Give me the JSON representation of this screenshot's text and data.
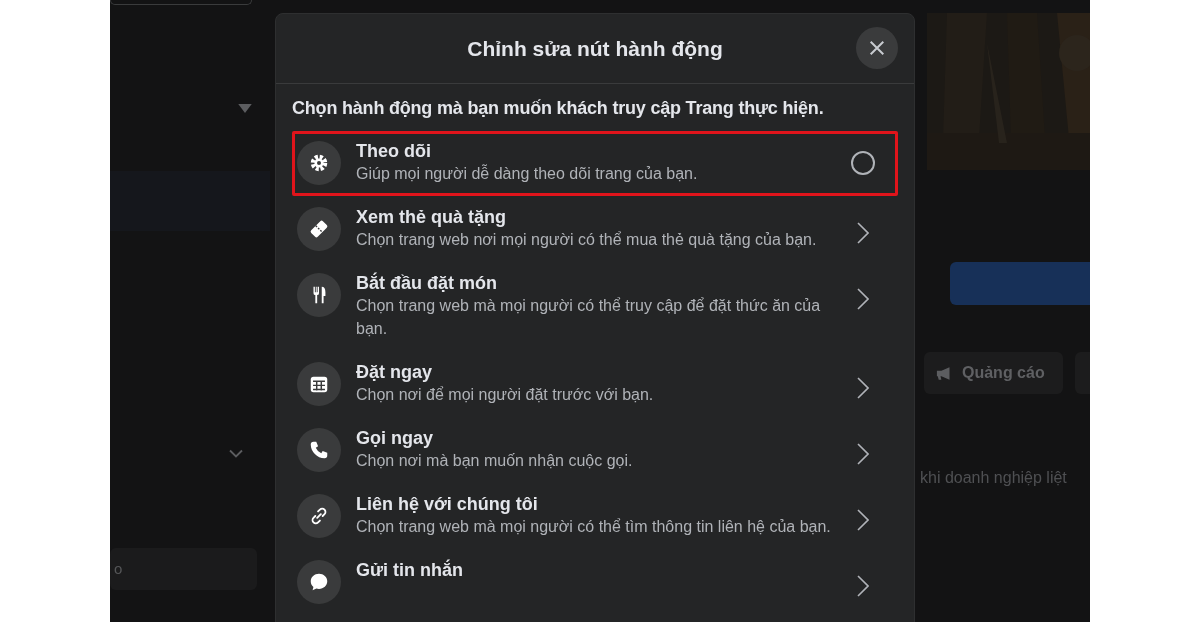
{
  "background": {
    "sidebar": {
      "field_text": "o"
    },
    "ad_button": {
      "label": "Quảng cáo"
    },
    "info_text": "khi doanh nghiệp liệt"
  },
  "dialog": {
    "title": "Chỉnh sửa nút hành động",
    "prompt": "Chọn hành động mà bạn muốn khách truy cập Trang thực hiện.",
    "actions": [
      {
        "kind": "radio",
        "title": "Theo dõi",
        "description": "Giúp mọi người dễ dàng theo dõi trang của bạn.",
        "selected": false,
        "highlighted": true
      },
      {
        "kind": "link",
        "title": "Xem thẻ quà tặng",
        "description": "Chọn trang web nơi mọi người có thể mua thẻ quà tặng của bạn.",
        "highlighted": false
      },
      {
        "kind": "link",
        "title": "Bắt đầu đặt món",
        "description": "Chọn trang web mà mọi người có thể truy cập để đặt thức ăn của bạn.",
        "highlighted": false
      },
      {
        "kind": "link",
        "title": "Đặt ngay",
        "description": "Chọn nơi để mọi người đặt trước với bạn.",
        "highlighted": false
      },
      {
        "kind": "link",
        "title": "Gọi ngay",
        "description": "Chọn nơi mà bạn muốn nhận cuộc gọi.",
        "highlighted": false
      },
      {
        "kind": "link",
        "title": "Liên hệ với chúng tôi",
        "description": "Chọn trang web mà mọi người có thể tìm thông tin liên hệ của bạn.",
        "highlighted": false
      },
      {
        "kind": "link",
        "title": "Gửi tin nhắn",
        "highlighted": false
      }
    ]
  }
}
